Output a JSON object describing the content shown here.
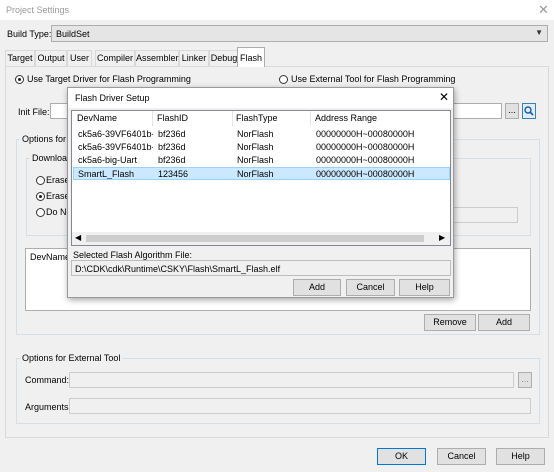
{
  "window": {
    "title": "Project Settings"
  },
  "build": {
    "label": "Build Type:",
    "value": "BuildSet"
  },
  "tabs": [
    {
      "label": "Target"
    },
    {
      "label": "Output"
    },
    {
      "label": "User"
    },
    {
      "label": "Compiler"
    },
    {
      "label": "Assembler"
    },
    {
      "label": "Linker"
    },
    {
      "label": "Debug"
    },
    {
      "label": "Flash",
      "active": true
    }
  ],
  "flash": {
    "use_target_driver": "Use Target Driver for Flash Programming",
    "use_external_tool": "Use External Tool for Flash Programming",
    "init_file_label": "Init File:",
    "init_browse": "...",
    "options_target_label": "Options for T",
    "download_label": "Downloa",
    "erase_1": "Erase",
    "erase_2": "Erase",
    "do_not": "Do No",
    "devname_label": "DevName",
    "remove_button": "Remove",
    "add_button": "Add",
    "options_external_label": "Options for External Tool",
    "command_label": "Command:",
    "command_browse": "...",
    "arguments_label": "Arguments:"
  },
  "dialog": {
    "title": "Flash Driver Setup",
    "columns": [
      "DevName",
      "FlashID",
      "FlashType",
      "Address Range"
    ],
    "rows": [
      [
        "ck5a6-39VF6401b-...",
        "bf236d",
        "NorFlash",
        "00000000H~00080000H"
      ],
      [
        "ck5a6-39VF6401b-l...",
        "bf236d",
        "NorFlash",
        "00000000H~00080000H"
      ],
      [
        "ck5a6-big-Uart",
        "bf236d",
        "NorFlash",
        "00000000H~00080000H"
      ],
      [
        "SmartL_Flash",
        "123456",
        "NorFlash",
        "00000000H~00080000H"
      ]
    ],
    "selected_row": 3,
    "selected_label": "Selected Flash Algorithm File:",
    "selected_path": "D:\\CDK\\cdk\\Runtime\\CSKY\\Flash\\SmartL_Flash.elf",
    "add": "Add",
    "cancel": "Cancel",
    "help": "Help"
  },
  "footer": {
    "ok": "OK",
    "cancel": "Cancel",
    "help": "Help"
  }
}
